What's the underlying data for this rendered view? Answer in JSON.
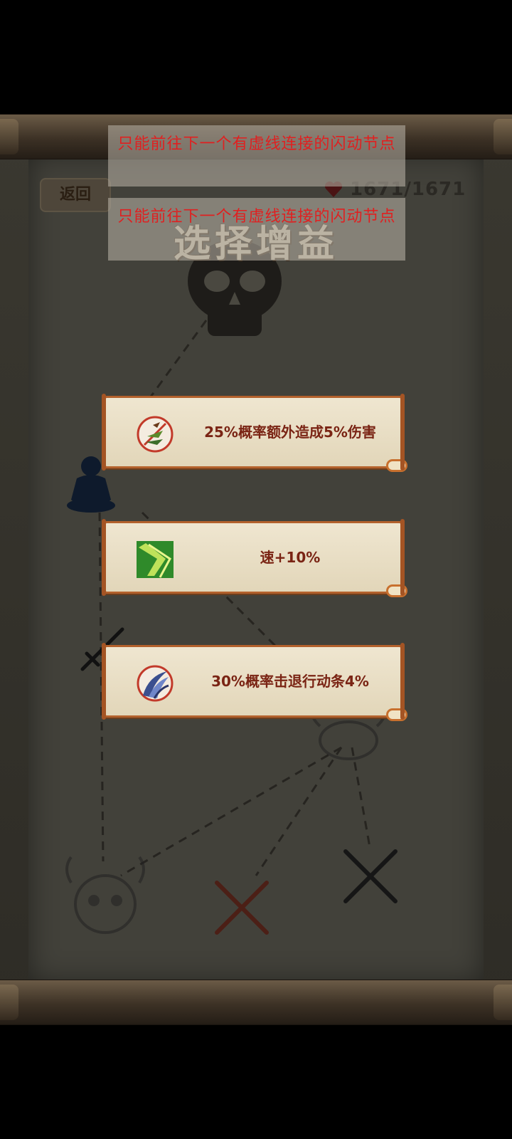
{
  "header": {
    "back_label": "返回",
    "hp_text": "1671/1671",
    "title": "选择增益"
  },
  "toasts": [
    {
      "text": "只能前往下一个有虚线连接的闪动节点"
    },
    {
      "text": "只能前往下一个有虚线连接的闪动节点"
    }
  ],
  "buffs": [
    {
      "icon": "arrows-icon",
      "text": "25%概率额外造成5%伤害"
    },
    {
      "icon": "speed-icon",
      "text": "速+10%"
    },
    {
      "icon": "claw-icon",
      "text": "30%概率击退行动条4%"
    }
  ],
  "colors": {
    "toast_text": "#e02020",
    "card_text": "#7a2414",
    "card_border": "#b3612c"
  }
}
